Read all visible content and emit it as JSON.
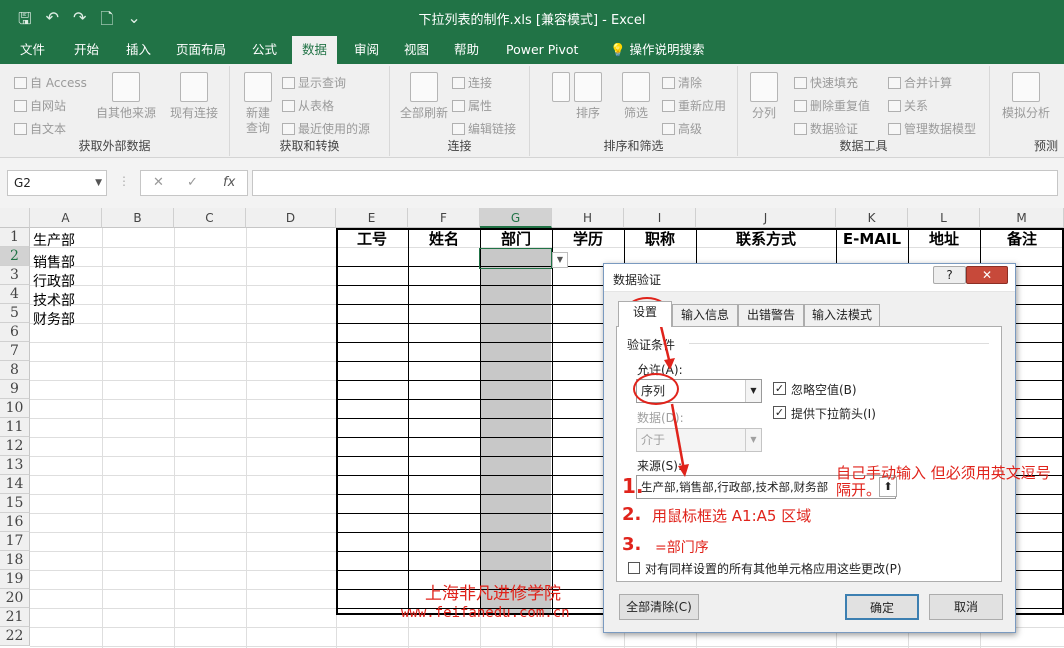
{
  "window": {
    "title": "下拉列表的制作.xls  [兼容模式]  -  Excel"
  },
  "qat": {
    "save": "🖫",
    "undo": "↶",
    "redo": "↷",
    "preview": "🗋",
    "more": "⌄"
  },
  "tabs": [
    "文件",
    "开始",
    "插入",
    "页面布局",
    "公式",
    "数据",
    "审阅",
    "视图",
    "帮助",
    "Power Pivot",
    "操作说明搜索"
  ],
  "ribbon": {
    "groups": [
      "获取外部数据",
      "获取和转换",
      "连接",
      "排序和筛选",
      "数据工具",
      "预测"
    ],
    "external": {
      "access": "自 Access",
      "web": "自网站",
      "text": "自文本",
      "other": "自其他来源",
      "existing": "现有连接"
    },
    "transform": {
      "new_query": "新建\n查询",
      "show_queries": "显示查询",
      "from_table": "从表格",
      "recent": "最近使用的源"
    },
    "connections": {
      "refresh_all": "全部刷新",
      "connections": "连接",
      "properties": "属性",
      "edit_links": "编辑链接"
    },
    "sort": {
      "sort": "排序",
      "filter": "筛选",
      "clear": "清除",
      "reapply": "重新应用",
      "advanced": "高级"
    },
    "tools": {
      "text_to_col": "分列",
      "flash_fill": "快速填充",
      "remove_dup": "删除重复值",
      "validation": "数据验证",
      "consolidate": "合并计算",
      "relationships": "关系",
      "manage_model": "管理数据模型"
    },
    "forecast": {
      "whatif": "模拟分析"
    }
  },
  "formula_bar": {
    "name_box": "G2",
    "fx": "fx"
  },
  "columns": [
    "A",
    "B",
    "C",
    "D",
    "E",
    "F",
    "G",
    "H",
    "I",
    "J",
    "K",
    "L",
    "M"
  ],
  "rows": [
    "1",
    "2",
    "3",
    "4",
    "5",
    "6",
    "7",
    "8",
    "9",
    "10",
    "11",
    "12",
    "13",
    "14",
    "15",
    "16",
    "17",
    "18",
    "19",
    "20",
    "21",
    "22"
  ],
  "colA": [
    "生产部",
    "销售部",
    "行政部",
    "技术部",
    "财务部"
  ],
  "table_headers": [
    "工号",
    "姓名",
    "部门",
    "学历",
    "职称",
    "联系方式",
    "E-MAIL",
    "地址",
    "备注"
  ],
  "dialog": {
    "title": "数据验证",
    "help": "?",
    "close": "✕",
    "tabs": [
      "设置",
      "输入信息",
      "出错警告",
      "输入法模式"
    ],
    "section": "验证条件",
    "allow_label": "允许(A):",
    "allow_value": "序列",
    "data_label": "数据(D):",
    "data_value": "介于",
    "ignore_blank": "忽略空值(B)",
    "dropdown": "提供下拉箭头(I)",
    "source_label": "来源(S):",
    "source_value": "生产部,销售部,行政部,技术部,财务部",
    "apply_all": "对有同样设置的所有其他单元格应用这些更改(P)",
    "clear_all": "全部清除(C)",
    "ok": "确定",
    "cancel": "取消"
  },
  "annotations": {
    "note_right": "自己手动输入  但必须用英文逗号隔开。",
    "step1": "1.",
    "step2": "2.",
    "step2_text": "用鼠标框选 A1:A5 区域",
    "step3": "3.",
    "step3_text": "=部门序",
    "watermark1": "上海非凡进修学院",
    "watermark2": "www.feifanedu.com.cn"
  }
}
